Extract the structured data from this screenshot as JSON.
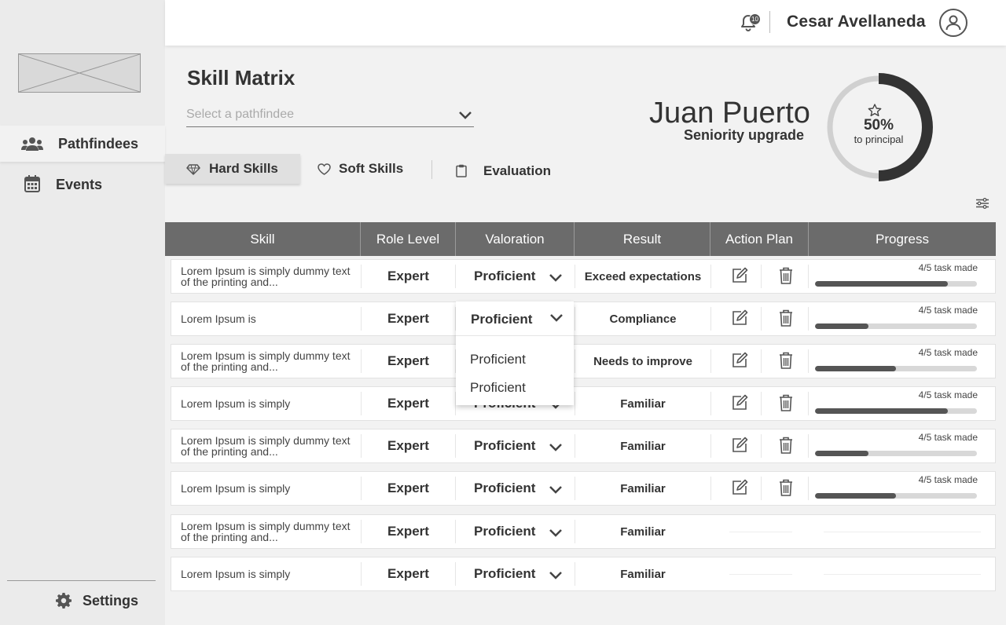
{
  "sidebar": {
    "nav": [
      {
        "label": "Pathfindees",
        "icon": "users-icon",
        "active": true
      },
      {
        "label": "Events",
        "icon": "calendar-icon",
        "active": false
      }
    ],
    "settings_label": "Settings"
  },
  "topbar": {
    "notification_count": "10",
    "user_name": "Cesar Avellaneda"
  },
  "page": {
    "title": "Skill Matrix",
    "select_placeholder": "Select a pathfindee",
    "tabs": [
      {
        "label": "Hard Skills",
        "icon": "diamond-icon",
        "active": true
      },
      {
        "label": "Soft Skills",
        "icon": "heart-icon",
        "active": false
      },
      {
        "label": "Evaluation",
        "icon": "clipboard-icon",
        "active": false
      }
    ]
  },
  "profile": {
    "name": "Juan Puerto",
    "subtitle": "Seniority upgrade",
    "progress_percent": 50,
    "progress_label": "50%",
    "progress_caption": "to principal"
  },
  "table": {
    "columns": [
      "Skill",
      "Role Level",
      "Valoration",
      "Result",
      "Action Plan",
      "Progress"
    ],
    "rows": [
      {
        "skill": "Lorem Ipsum is simply dummy text of the printing and...",
        "role": "Expert",
        "valoration": "Proficient",
        "result": "Exceed expectations",
        "progress_label": "4/5 task made",
        "progress": 0.82,
        "actions": true
      },
      {
        "skill": "Lorem Ipsum is",
        "role": "Expert",
        "valoration": "Proficient",
        "result": "Compliance",
        "progress_label": "4/5 task made",
        "progress": 0.33,
        "actions": true
      },
      {
        "skill": "Lorem Ipsum is simply dummy text of the printing and...",
        "role": "Expert",
        "valoration": "Proficient",
        "result": "Needs to improve",
        "progress_label": "4/5 task made",
        "progress": 0.5,
        "actions": true
      },
      {
        "skill": "Lorem Ipsum is simply",
        "role": "Expert",
        "valoration": "Proficient",
        "result": "Familiar",
        "progress_label": "4/5 task made",
        "progress": 0.82,
        "actions": true
      },
      {
        "skill": "Lorem Ipsum is simply dummy text of the printing and...",
        "role": "Expert",
        "valoration": "Proficient",
        "result": "Familiar",
        "progress_label": "4/5 task made",
        "progress": 0.33,
        "actions": true
      },
      {
        "skill": "Lorem Ipsum is simply",
        "role": "Expert",
        "valoration": "Proficient",
        "result": "Familiar",
        "progress_label": "4/5 task made",
        "progress": 0.5,
        "actions": true
      },
      {
        "skill": "Lorem Ipsum is simply dummy text of the printing and...",
        "role": "Expert",
        "valoration": "Proficient",
        "result": "Familiar",
        "actions": false
      },
      {
        "skill": "Lorem Ipsum is simply",
        "role": "Expert",
        "valoration": "Proficient",
        "result": "Familiar",
        "actions": false
      }
    ],
    "open_dropdown": {
      "row_index": 1,
      "selected": "Proficient",
      "options": [
        "Proficient",
        "Proficient"
      ]
    }
  },
  "colors": {
    "header_bg": "#6b6b6b",
    "progress_fill": "#555555",
    "progress_track": "#d8d8d8"
  }
}
